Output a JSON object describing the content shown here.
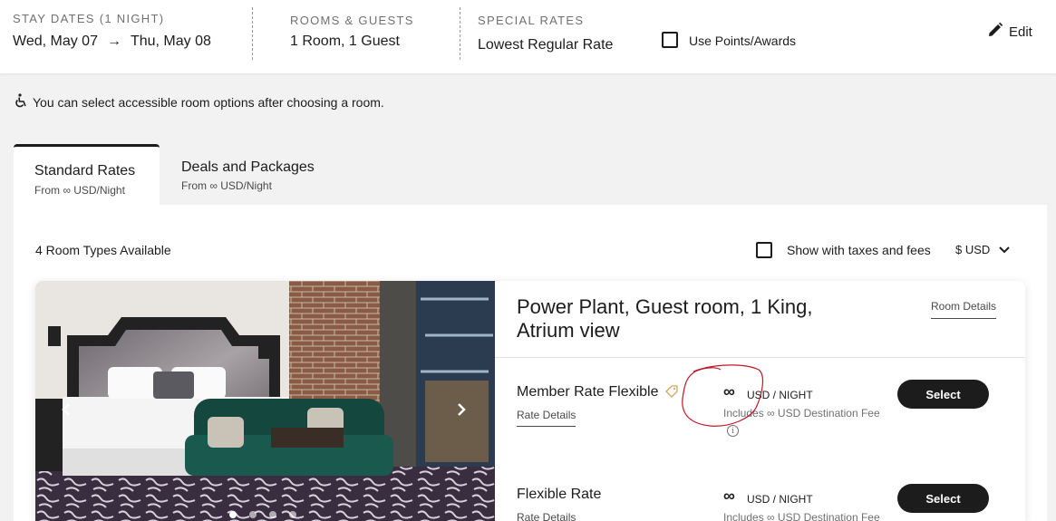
{
  "search": {
    "stay": {
      "label": "STAY DATES (1 NIGHT)",
      "checkin": "Wed, May 07",
      "arrow": "→",
      "checkout": "Thu, May 08"
    },
    "rooms": {
      "label": "ROOMS & GUESTS",
      "value": "1 Room, 1 Guest"
    },
    "rates": {
      "label": "SPECIAL RATES",
      "value": "Lowest Regular Rate"
    },
    "points_label": "Use Points/Awards",
    "edit_label": "Edit"
  },
  "notice": "You can select accessible room options after choosing a room.",
  "tabs": [
    {
      "title": "Standard Rates",
      "subtitle": "From ∞ USD/Night",
      "active": true
    },
    {
      "title": "Deals and Packages",
      "subtitle": "From ∞ USD/Night",
      "active": false
    }
  ],
  "results": {
    "count": "4 Room Types Available",
    "taxes_label": "Show with taxes and fees",
    "currency": "$ USD"
  },
  "room": {
    "title": "Power Plant, Guest room, 1 King, Atrium view",
    "details_link": "Room Details",
    "gallery_dots": 4,
    "rates": [
      {
        "name": "Member Rate Flexible",
        "details": "Rate Details",
        "price": "∞",
        "unit": "USD / NIGHT",
        "fee": "Includes ∞ USD Destination Fee",
        "select": "Select"
      },
      {
        "name": "Flexible Rate",
        "details": "Rate Details",
        "price": "∞",
        "unit": "USD / NIGHT",
        "fee": "Includes ∞ USD Destination Fee",
        "select": "Select"
      }
    ]
  },
  "colors": {
    "primary": "#1c1c1c",
    "muted": "#707070",
    "annotation": "#c0182a"
  }
}
